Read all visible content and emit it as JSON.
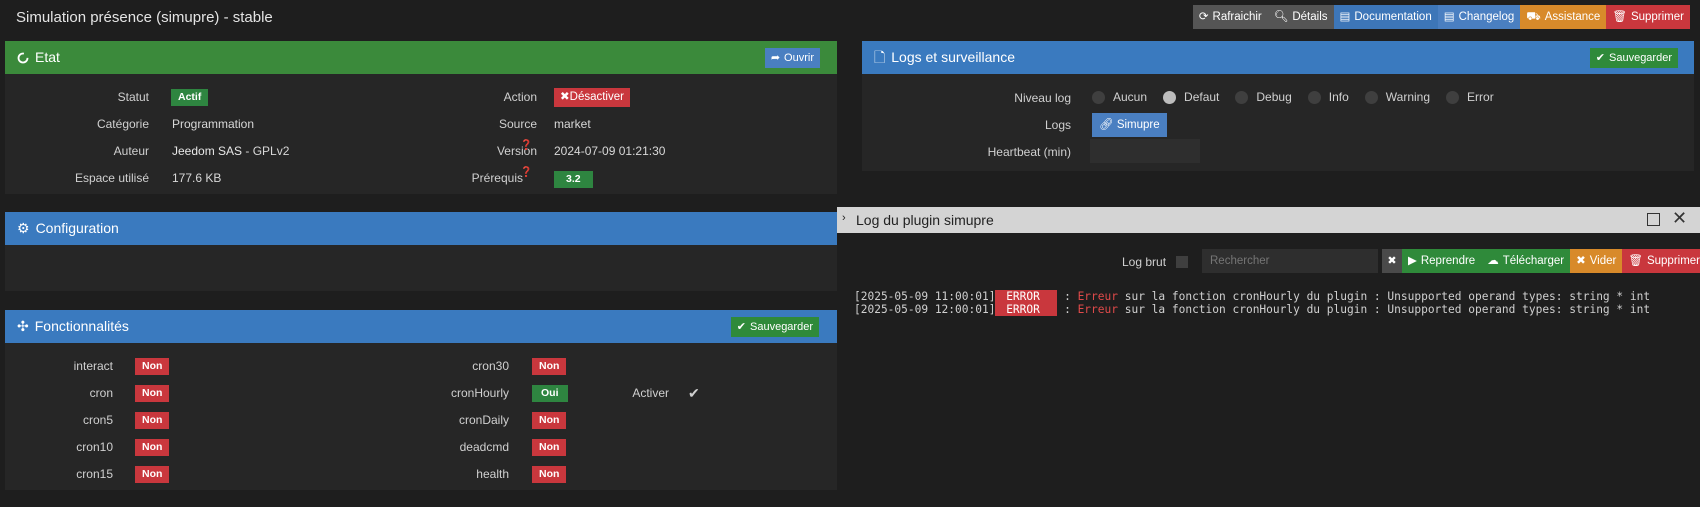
{
  "page": {
    "title": "Simulation présence (simupre) - stable"
  },
  "toolbar": {
    "refresh": "Rafraichir",
    "details": "Détails",
    "documentation": "Documentation",
    "changelog": "Changelog",
    "assistance": "Assistance",
    "delete": "Supprimer"
  },
  "etat": {
    "title": "Etat",
    "open_label": "Ouvrir",
    "statut_label": "Statut",
    "statut_value": "Actif",
    "action_label": "Action",
    "action_value": "Désactiver",
    "categorie_label": "Catégorie",
    "categorie_value": "Programmation",
    "source_label": "Source",
    "source_value": "market",
    "auteur_label": "Auteur",
    "auteur_value": "Jeedom SAS",
    "licence": "- GPLv2",
    "version_label": "Version",
    "version_value": "2024-07-09 01:21:30",
    "espace_label": "Espace utilisé",
    "espace_value": "177.6 KB",
    "prerequis_label": "Prérequis",
    "prerequis_value": "3.2"
  },
  "logs": {
    "title": "Logs et surveillance",
    "save_label": "Sauvegarder",
    "niveau_label": "Niveau log",
    "levels": [
      "Aucun",
      "Defaut",
      "Debug",
      "Info",
      "Warning",
      "Error"
    ],
    "selected_level": "Defaut",
    "logs_label": "Logs",
    "log_button": "Simupre",
    "heartbeat_label": "Heartbeat (min)",
    "heartbeat_value": ""
  },
  "configuration": {
    "title": "Configuration"
  },
  "fonctionnalites": {
    "title": "Fonctionnalités",
    "save_label": "Sauvegarder",
    "col1": [
      {
        "name": "interact",
        "value": "Non"
      },
      {
        "name": "cron",
        "value": "Non"
      },
      {
        "name": "cron5",
        "value": "Non"
      },
      {
        "name": "cron10",
        "value": "Non"
      },
      {
        "name": "cron15",
        "value": "Non"
      }
    ],
    "col2": [
      {
        "name": "cron30",
        "value": "Non"
      },
      {
        "name": "cronHourly",
        "value": "Oui"
      },
      {
        "name": "cronDaily",
        "value": "Non"
      },
      {
        "name": "deadcmd",
        "value": "Non"
      },
      {
        "name": "health",
        "value": "Non"
      }
    ],
    "activer_label": "Activer",
    "activer_checked": true
  },
  "log_window": {
    "title": "Log du plugin simupre",
    "log_brut_label": "Log brut",
    "search_placeholder": "Rechercher",
    "resume": "Reprendre",
    "download": "Télécharger",
    "clear": "Vider",
    "delete": "Supprimer",
    "lines": [
      {
        "ts": "[2025-05-09 11:00:01]",
        "level": " ERROR  ",
        "pre": " : ",
        "err": "Erreur",
        "msg": " sur la fonction cronHourly du plugin : Unsupported operand types: string * int"
      },
      {
        "ts": "[2025-05-09 12:00:01]",
        "level": " ERROR  ",
        "pre": " : ",
        "err": "Erreur",
        "msg": " sur la fonction cronHourly du plugin : Unsupported operand types: string * int"
      }
    ]
  },
  "colors": {
    "green_header": "#3b8a3b",
    "blue_header": "#3a7abf",
    "badge_green": "#2e8540",
    "badge_red": "#c9373d"
  }
}
